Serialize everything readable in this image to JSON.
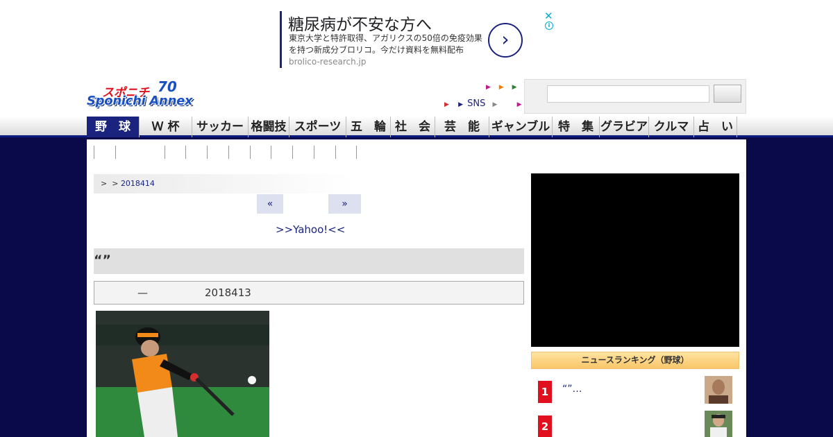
{
  "ad": {
    "title": "糖尿病が不安な方へ",
    "body": "東京大学と特許取得、アガリクスの50倍の免疫効果を持つ新成分ブロリコ。今だけ資料を無料配布",
    "domain": "brolico-research.jp",
    "arrow": "›",
    "close": "✕",
    "info": "i"
  },
  "logo": {
    "top": "スポニチ",
    "badge": "70",
    "main": "Sponichi Annex"
  },
  "header": {
    "sns_label": "SNS",
    "tri_marker": "▶",
    "colors": {
      "magenta": "#c2188a",
      "orange": "#f57c00",
      "green": "#2e7d32",
      "red": "#d32f2f",
      "blue": "#1a237e"
    }
  },
  "nav": {
    "items": [
      {
        "label": "野　球",
        "active": true
      },
      {
        "label": "Ｗ 杯"
      },
      {
        "label": "サッカー"
      },
      {
        "label": "格闘技"
      },
      {
        "label": "スポーツ"
      },
      {
        "label": "五　輪"
      },
      {
        "label": "社　会"
      },
      {
        "label": "芸　能"
      },
      {
        "label": "ギャンブル"
      },
      {
        "label": "特　集"
      },
      {
        "label": "グラビア"
      },
      {
        "label": "クルマ"
      },
      {
        "label": "占　い"
      }
    ]
  },
  "breadcrumb": {
    "sep1": ">",
    "sep2": ">",
    "date": "2018414"
  },
  "pager": {
    "prev": "«",
    "next": "»"
  },
  "article": {
    "yahoo_link": ">>Yahoo!<<",
    "title": "“”",
    "byline_dash": "—",
    "byline_date": "2018413"
  },
  "sidebar": {
    "ranking_title": "ニュースランキング（野球）",
    "ranking": [
      {
        "rank": "1",
        "text": "“”…"
      },
      {
        "rank": "2",
        "text": ""
      }
    ]
  },
  "colors": {
    "navy": "#0a0a4a",
    "nav_active": "#1a237e",
    "rank_red": "#e0101e"
  }
}
